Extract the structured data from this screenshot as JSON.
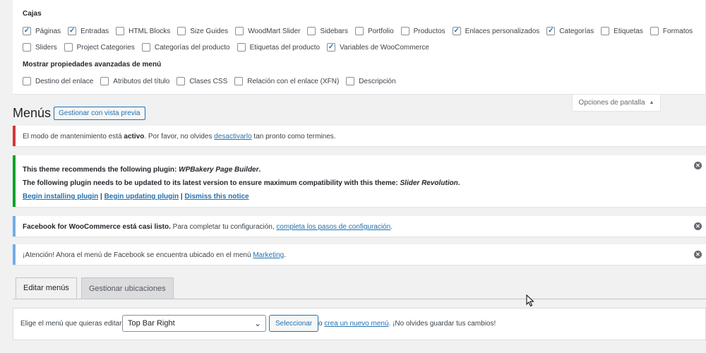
{
  "screen_options": {
    "boxes_heading": "Cajas",
    "boxes_row1": [
      {
        "label": "Páginas",
        "checked": true
      },
      {
        "label": "Entradas",
        "checked": true
      },
      {
        "label": "HTML Blocks",
        "checked": false
      },
      {
        "label": "Size Guides",
        "checked": false
      },
      {
        "label": "WoodMart Slider",
        "checked": false
      },
      {
        "label": "Sidebars",
        "checked": false
      },
      {
        "label": "Portfolio",
        "checked": false
      },
      {
        "label": "Productos",
        "checked": false
      },
      {
        "label": "Enlaces personalizados",
        "checked": true
      },
      {
        "label": "Categorías",
        "checked": true
      },
      {
        "label": "Etiquetas",
        "checked": false
      },
      {
        "label": "Formatos",
        "checked": false
      }
    ],
    "boxes_row2": [
      {
        "label": "Sliders",
        "checked": false
      },
      {
        "label": "Project Categories",
        "checked": false
      },
      {
        "label": "Categorías del producto",
        "checked": false
      },
      {
        "label": "Etiquetas del producto",
        "checked": false
      },
      {
        "label": "Variables de WooCommerce",
        "checked": true
      }
    ],
    "advanced_heading": "Mostrar propiedades avanzadas de menú",
    "advanced": [
      {
        "label": "Destino del enlace",
        "checked": false
      },
      {
        "label": "Atributos del título",
        "checked": false
      },
      {
        "label": "Clases CSS",
        "checked": false
      },
      {
        "label": "Relación con el enlace (XFN)",
        "checked": false
      },
      {
        "label": "Descripción",
        "checked": false
      }
    ],
    "tab_label": "Opciones de pantalla"
  },
  "header": {
    "title": "Menús",
    "preview_button": "Gestionar con vista previa"
  },
  "notices": {
    "maintenance": {
      "pre": "El modo de mantenimiento está ",
      "bold": "activo",
      "mid": ". Por favor, no olvides ",
      "link": "desactivarlo",
      "post": " tan pronto como termines."
    },
    "plugins": {
      "line1_pre": "This theme recommends the following plugin: ",
      "line1_plugin": "WPBakery Page Builder",
      "line1_post": ".",
      "line2_pre": "The following plugin needs to be updated to its latest version to ensure maximum compatibility with this theme: ",
      "line2_plugin": "Slider Revolution",
      "line2_post": ".",
      "link_install": "Begin installing plugin",
      "sep1": " | ",
      "link_update": "Begin updating plugin",
      "sep2": " | ",
      "link_dismiss": "Dismiss this notice"
    },
    "facebook_setup": {
      "bold": "Facebook for WooCommerce está casi listo.",
      "mid": " Para completar tu configuración, ",
      "link": "completa los pasos de configuración",
      "post": "."
    },
    "facebook_menu": {
      "pre": "¡Atención! Ahora el menú de Facebook se encuentra ubicado en el menú ",
      "link": "Marketing",
      "post": "."
    },
    "dismiss_glyph": "✕"
  },
  "tabs": [
    {
      "label": "Editar menús",
      "active": true
    },
    {
      "label": "Gestionar ubicaciones",
      "active": false
    }
  ],
  "manage": {
    "label": "Elige el menú que quieras editar:",
    "selected": "Top Bar Right",
    "select_button": "Seleccionar",
    "or_text": "o ",
    "create_link": "crea un nuevo menú",
    "tail": ". ¡No olvides guardar tus cambios!"
  },
  "icons": {
    "check": "check-icon",
    "dismiss": "dismiss-icon",
    "chevron": "chevron-down-icon",
    "arrow_up": "arrow-up-icon",
    "cursor": "mouse-cursor-icon"
  },
  "colors": {
    "link": "#2271b1",
    "error_border": "#d63638",
    "success_border": "#00a32a",
    "info_border": "#72aee6"
  }
}
